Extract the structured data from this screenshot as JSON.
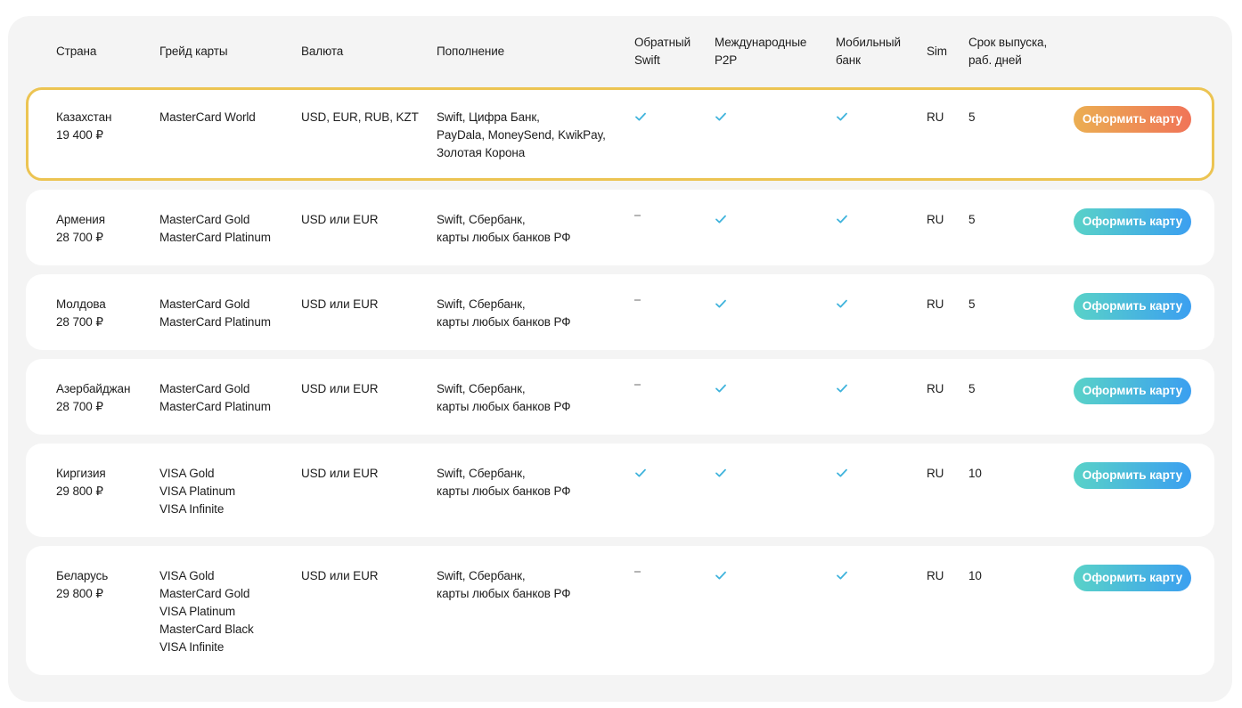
{
  "header": {
    "country": "Страна",
    "grade": "Грейд карты",
    "currency": "Валюта",
    "topup": "Пополнение",
    "reverse_swift": [
      "Обратный",
      "Swift"
    ],
    "intl_p2p": [
      "Международные",
      "P2P"
    ],
    "mobile_bank": [
      "Мобильный",
      "банк"
    ],
    "sim": "Sim",
    "issue_term": [
      "Срок выпуска,",
      "раб. дней"
    ]
  },
  "rows": [
    {
      "country": "Казахстан",
      "price": "19 400 ₽",
      "grades": [
        "MasterCard World"
      ],
      "currency": "USD, EUR, RUB, KZT",
      "topup": [
        "Swift, Цифра Банк,",
        "PayDala, MoneySend, KwikPay,",
        "Золотая Корона"
      ],
      "reverse_swift": true,
      "intl_p2p": true,
      "mobile_bank": true,
      "sim": "RU",
      "days": "5",
      "button": "Оформить карту",
      "highlighted": true
    },
    {
      "country": "Армения",
      "price": "28 700 ₽",
      "grades": [
        "MasterCard Gold",
        "MasterCard Platinum"
      ],
      "currency": "USD или EUR",
      "topup": [
        "Swift, Сбербанк,",
        "карты любых банков РФ"
      ],
      "reverse_swift": false,
      "intl_p2p": true,
      "mobile_bank": true,
      "sim": "RU",
      "days": "5",
      "button": "Оформить карту"
    },
    {
      "country": "Молдова",
      "price": "28 700 ₽",
      "grades": [
        "MasterCard Gold",
        "MasterCard Platinum"
      ],
      "currency": "USD или EUR",
      "topup": [
        "Swift, Сбербанк,",
        "карты любых банков РФ"
      ],
      "reverse_swift": false,
      "intl_p2p": true,
      "mobile_bank": true,
      "sim": "RU",
      "days": "5",
      "button": "Оформить карту"
    },
    {
      "country": "Азербайджан",
      "price": "28 700 ₽",
      "grades": [
        "MasterCard Gold",
        "MasterCard Platinum"
      ],
      "currency": "USD или EUR",
      "topup": [
        "Swift, Сбербанк,",
        "карты любых банков РФ"
      ],
      "reverse_swift": false,
      "intl_p2p": true,
      "mobile_bank": true,
      "sim": "RU",
      "days": "5",
      "button": "Оформить карту"
    },
    {
      "country": "Киргизия",
      "price": "29 800 ₽",
      "grades": [
        "VISA Gold",
        "VISA Platinum",
        "VISA Infinite"
      ],
      "currency": "USD или EUR",
      "topup": [
        "Swift, Сбербанк,",
        "карты любых банков РФ"
      ],
      "reverse_swift": true,
      "intl_p2p": true,
      "mobile_bank": true,
      "sim": "RU",
      "days": "10",
      "button": "Оформить карту"
    },
    {
      "country": "Беларусь",
      "price": "29 800 ₽",
      "grades": [
        "VISA Gold",
        "MasterCard Gold",
        "VISA Platinum",
        "MasterCard Black",
        "VISA Infinite"
      ],
      "currency": "USD или EUR",
      "topup": [
        "Swift, Сбербанк,",
        "карты любых банков РФ"
      ],
      "reverse_swift": false,
      "intl_p2p": true,
      "mobile_bank": true,
      "sim": "RU",
      "days": "10",
      "button": "Оформить карту"
    }
  ],
  "icons": {
    "yes": "check-icon",
    "no": "dash-icon",
    "check_color": "#3fb3dc"
  },
  "colors": {
    "highlight_border": "#ecc452",
    "button_gradient": [
      "#59d2c8",
      "#3b9ff0"
    ],
    "highlight_button_gradient": [
      "#ebae52",
      "#f07458"
    ]
  }
}
